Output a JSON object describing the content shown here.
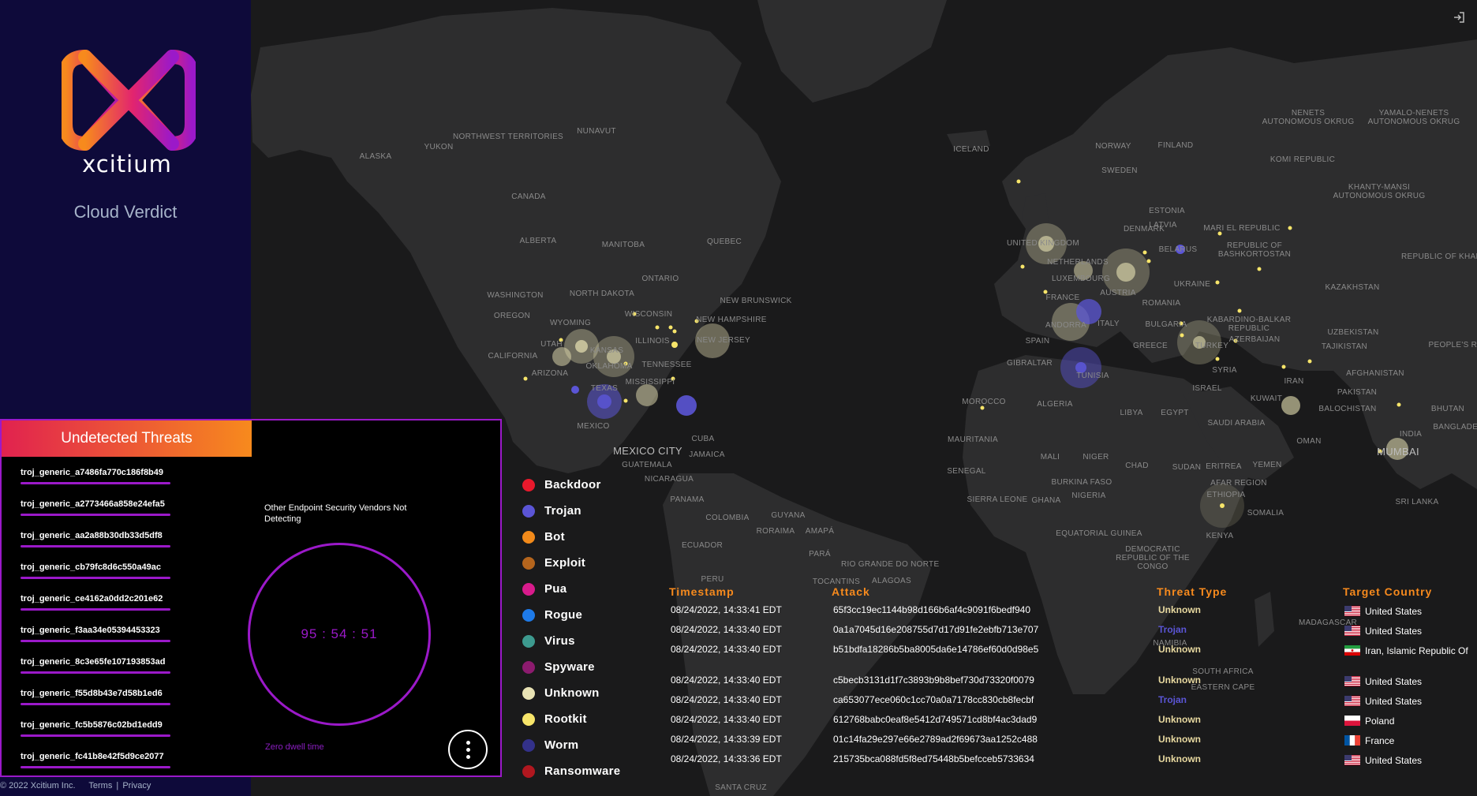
{
  "brand": {
    "name": "xcitium",
    "subtitle": "Cloud Verdict",
    "footer_copyright": "© 2022 Xcitium Inc.",
    "footer_terms": "Terms",
    "footer_sep": "|",
    "footer_privacy": "Privacy"
  },
  "panel": {
    "title": "Undetected Threats",
    "threats": [
      "troj_generic_a7486fa770c186f8b49",
      "troj_generic_a2773466a858e24efa5",
      "troj_generic_aa2a88b30db33d5df8",
      "troj_generic_cb79fc8d6c550a49ac",
      "troj_generic_ce4162a0dd2c201e62",
      "troj_generic_f3aa34e05394453323",
      "troj_generic_8c3e65fe107193853ad",
      "troj_generic_f55d8b43e7d58b1ed6",
      "troj_generic_fc5b5876c02bd1edd9",
      "troj_generic_fc41b8e42f5d9ce2077"
    ],
    "vendors_text": "Other Endpoint Security Vendors Not Detecting",
    "timer": "95 : 54 : 51",
    "dwell_label": "Zero dwell time",
    "menu_icon": "vertical-dots-icon"
  },
  "legend": [
    {
      "label": "Backdoor",
      "color": "#e8192c"
    },
    {
      "label": "Trojan",
      "color": "#5b55d6"
    },
    {
      "label": "Bot",
      "color": "#f28a1a"
    },
    {
      "label": "Exploit",
      "color": "#b5651d"
    },
    {
      "label": "Pua",
      "color": "#d81b8c"
    },
    {
      "label": "Rogue",
      "color": "#1e7ae8"
    },
    {
      "label": "Virus",
      "color": "#3d9a8f"
    },
    {
      "label": "Spyware",
      "color": "#8c1b6e"
    },
    {
      "label": "Unknown",
      "color": "#e8e2b4"
    },
    {
      "label": "Rootkit",
      "color": "#f7e56a"
    },
    {
      "label": "Worm",
      "color": "#33318a"
    },
    {
      "label": "Ransomware",
      "color": "#b0171f"
    }
  ],
  "table": {
    "headers": {
      "timestamp": "Timestamp",
      "attack": "Attack",
      "threat_type": "Threat Type",
      "target_country": "Target Country"
    },
    "rows": [
      {
        "timestamp": "08/24/2022, 14:33:41 EDT",
        "attack": "65f3cc19ec1144b98d166b6af4c9091f6bedf940",
        "threat_type": "Unknown",
        "type_color": "#e8d9a0",
        "country": "United States",
        "flag": "us"
      },
      {
        "timestamp": "08/24/2022, 14:33:40 EDT",
        "attack": "0a1a7045d16e208755d7d17d91fe2ebfb713e707",
        "threat_type": "Trojan",
        "type_color": "#5b55d6",
        "country": "United States",
        "flag": "us"
      },
      {
        "timestamp": "08/24/2022, 14:33:40 EDT",
        "attack": "b51bdfa18286b5ba8005da6e14786ef60d0d98e5",
        "threat_type": "Unknown",
        "type_color": "#e8d9a0",
        "country": "Iran, Islamic Republic Of",
        "flag": "ir"
      },
      {
        "timestamp": "08/24/2022, 14:33:40 EDT",
        "attack": "c5becb3131d1f7c3893b9b8bef730d73320f0079",
        "threat_type": "Unknown",
        "type_color": "#e8d9a0",
        "country": "United States",
        "flag": "us"
      },
      {
        "timestamp": "08/24/2022, 14:33:40 EDT",
        "attack": "ca653077ece060c1cc70a0a7178cc830cb8fecbf",
        "threat_type": "Trojan",
        "type_color": "#5b55d6",
        "country": "United States",
        "flag": "us"
      },
      {
        "timestamp": "08/24/2022, 14:33:40 EDT",
        "attack": "612768babc0eaf8e5412d749571cd8bf4ac3dad9",
        "threat_type": "Unknown",
        "type_color": "#e8d9a0",
        "country": "Poland",
        "flag": "pl"
      },
      {
        "timestamp": "08/24/2022, 14:33:39 EDT",
        "attack": "01c14fa29e297e66e2789ad2f69673aa1252c488",
        "threat_type": "Unknown",
        "type_color": "#e8d9a0",
        "country": "France",
        "flag": "fr"
      },
      {
        "timestamp": "08/24/2022, 14:33:36 EDT",
        "attack": "215735bca088fd5f8ed75448b5befcceb5733634",
        "threat_type": "Unknown",
        "type_color": "#e8d9a0",
        "country": "United States",
        "flag": "us"
      }
    ]
  },
  "map_labels": [
    {
      "text": "NUNAVUT"
    },
    {
      "text": "NORTHWEST TERRITORIES"
    },
    {
      "text": "YUKON"
    },
    {
      "text": "ALASKA"
    },
    {
      "text": "CANADA"
    },
    {
      "text": "ALBERTA"
    },
    {
      "text": "MANITOBA"
    },
    {
      "text": "QUEBEC"
    },
    {
      "text": "ONTARIO"
    },
    {
      "text": "WASHINGTON"
    },
    {
      "text": "NORTH DAKOTA"
    },
    {
      "text": "NEW BRUNSWICK"
    },
    {
      "text": "OREGON"
    },
    {
      "text": "WISCONSIN"
    },
    {
      "text": "NEW HAMPSHIRE"
    },
    {
      "text": "WYOMING"
    },
    {
      "text": "ILLINOIS"
    },
    {
      "text": "NEW JERSEY"
    },
    {
      "text": "UTAH"
    },
    {
      "text": "KANSAS"
    },
    {
      "text": "CALIFORNIA"
    },
    {
      "text": "OKLAHOMA"
    },
    {
      "text": "TENNESSEE"
    },
    {
      "text": "ARIZONA"
    },
    {
      "text": "MISSISSIPPI"
    },
    {
      "text": "TEXAS"
    },
    {
      "text": "MEXICO"
    },
    {
      "text": "CUBA"
    },
    {
      "text": "MEXICO CITY"
    },
    {
      "text": "JAMAICA"
    },
    {
      "text": "GUATEMALA"
    },
    {
      "text": "NICARAGUA"
    },
    {
      "text": "PANAMA"
    },
    {
      "text": "COLOMBIA"
    },
    {
      "text": "GUYANA"
    },
    {
      "text": "RORAIMA"
    },
    {
      "text": "AMAPÁ"
    },
    {
      "text": "ECUADOR"
    },
    {
      "text": "PARÁ"
    },
    {
      "text": "PERU"
    },
    {
      "text": "TOCANTINS"
    },
    {
      "text": "RIO GRANDE DO NORTE"
    },
    {
      "text": "ALAGOAS"
    },
    {
      "text": "SANTA CRUZ"
    },
    {
      "text": "ICELAND"
    },
    {
      "text": "NORWAY"
    },
    {
      "text": "FINLAND"
    },
    {
      "text": "SWEDEN"
    },
    {
      "text": "NENETS AUTONOMOUS OKRUG"
    },
    {
      "text": "YAMALO-NENETS AUTONOMOUS OKRUG"
    },
    {
      "text": "KOMI REPUBLIC"
    },
    {
      "text": "KHANTY-MANSI AUTONOMOUS OKRUG"
    },
    {
      "text": "ESTONIA"
    },
    {
      "text": "LATVIA"
    },
    {
      "text": "DENMARK"
    },
    {
      "text": "UNITED KINGDOM"
    },
    {
      "text": "MARI EL REPUBLIC"
    },
    {
      "text": "REPUBLIC OF BASHKORTOSTAN"
    },
    {
      "text": "REPUBLIC OF KHAKASSIA"
    },
    {
      "text": "BELARUS"
    },
    {
      "text": "NETHERLANDS"
    },
    {
      "text": "LUXEMBOURG"
    },
    {
      "text": "UKRAINE"
    },
    {
      "text": "KAZAKHSTAN"
    },
    {
      "text": "FRANCE"
    },
    {
      "text": "AUSTRIA"
    },
    {
      "text": "ROMANIA"
    },
    {
      "text": "ANDORRA"
    },
    {
      "text": "ITALY"
    },
    {
      "text": "BULGARIA"
    },
    {
      "text": "KABARDINO-BALKAR REPUBLIC"
    },
    {
      "text": "UZBEKISTAN"
    },
    {
      "text": "SPAIN"
    },
    {
      "text": "GREECE"
    },
    {
      "text": "TURKEY"
    },
    {
      "text": "AZERBAIJAN"
    },
    {
      "text": "TAJIKISTAN"
    },
    {
      "text": "PEOPLE'S REP. OF"
    },
    {
      "text": "GIBRALTAR"
    },
    {
      "text": "TUNISIA"
    },
    {
      "text": "SYRIA"
    },
    {
      "text": "AFGHANISTAN"
    },
    {
      "text": "ISRAEL"
    },
    {
      "text": "IRAN"
    },
    {
      "text": "PAKISTAN"
    },
    {
      "text": "MOROCCO"
    },
    {
      "text": "ALGERIA"
    },
    {
      "text": "LIBYA"
    },
    {
      "text": "EGYPT"
    },
    {
      "text": "KUWAIT"
    },
    {
      "text": "BALOCHISTAN"
    },
    {
      "text": "BHUTAN"
    },
    {
      "text": "SAUDI ARABIA"
    },
    {
      "text": "INDIA"
    },
    {
      "text": "BANGLADESH"
    },
    {
      "text": "MAURITANIA"
    },
    {
      "text": "MALI"
    },
    {
      "text": "NIGER"
    },
    {
      "text": "OMAN"
    },
    {
      "text": "MUMBAI"
    },
    {
      "text": "SENEGAL"
    },
    {
      "text": "CHAD"
    },
    {
      "text": "SUDAN"
    },
    {
      "text": "ERITREA"
    },
    {
      "text": "YEMEN"
    },
    {
      "text": "BURKINA FASO"
    },
    {
      "text": "AFAR REGION"
    },
    {
      "text": "SIERRA LEONE"
    },
    {
      "text": "GHANA"
    },
    {
      "text": "NIGERIA"
    },
    {
      "text": "ETHIOPIA"
    },
    {
      "text": "SRI LANKA"
    },
    {
      "text": "SOMALIA"
    },
    {
      "text": "EQUATORIAL GUINEA"
    },
    {
      "text": "KENYA"
    },
    {
      "text": "DEMOCRATIC REPUBLIC OF THE CONGO"
    },
    {
      "text": "MADAGASCAR"
    },
    {
      "text": "NAMIBIA"
    },
    {
      "text": "SOUTH AFRICA"
    },
    {
      "text": "EASTERN CAPE"
    }
  ]
}
